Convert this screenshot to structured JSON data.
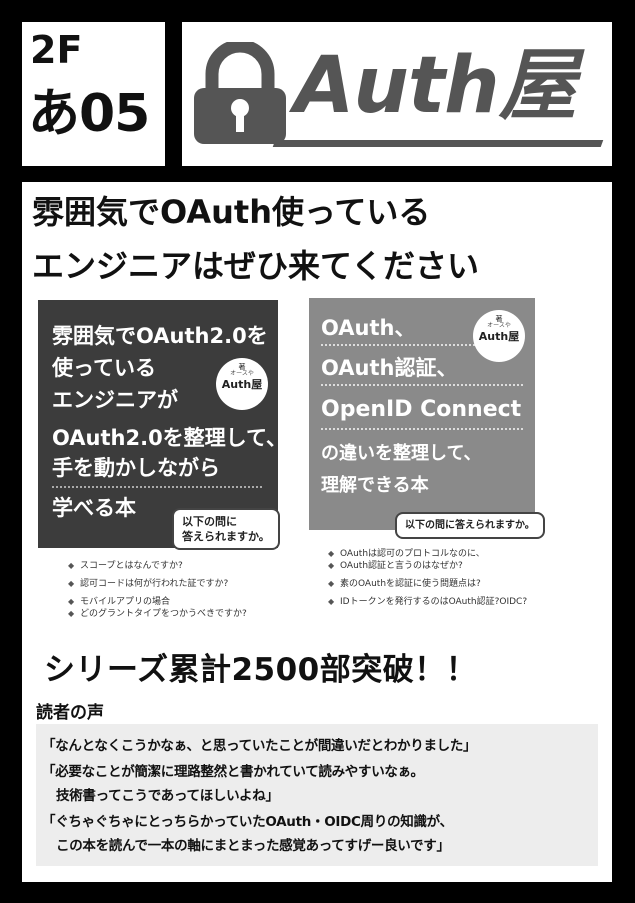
{
  "booth": {
    "floor": "2F",
    "number": "あ05"
  },
  "logo": {
    "text": "Auth屋",
    "icon": "lock-icon"
  },
  "headline": {
    "line1": "雰囲気でOAuth使っている",
    "line2": "エンジニアはぜひ来てください"
  },
  "book1": {
    "title_lines": [
      "雰囲気でOAuth2.0を",
      "使っている",
      "エンジニアが",
      "OAuth2.0を整理して、",
      "手を動かしながら",
      "学べる本"
    ],
    "badge": {
      "small": "著",
      "ruby": "オースや",
      "name": "Auth屋"
    },
    "bubble": [
      "以下の問に",
      "答えられますか。"
    ],
    "questions": [
      "スコープとはなんですか?",
      "認可コードは何が行われた証ですか?",
      "モバイルアプリの場合",
      "どのグラントタイプをつかうべきですか?"
    ]
  },
  "book2": {
    "title_lines": [
      "OAuth、",
      "OAuth認証、",
      "OpenID Connect",
      "の違いを整理して、",
      "理解できる本"
    ],
    "badge": {
      "small": "著",
      "ruby": "オースや",
      "name": "Auth屋"
    },
    "bubble": "以下の問に答えられますか。",
    "questions": [
      "OAuthは認可のプロトコルなのに、",
      "OAuth認証と言うのはなぜか?",
      "素のOAuthを認証に使う問題点は?",
      "IDトークンを発行するのはOAuth認証?OIDC?"
    ]
  },
  "series": "シリーズ累計2500部突破！！",
  "reviews": {
    "title": "読者の声",
    "lines": [
      "「なんとなくこうかなぁ、と思っていたことが間違いだとわかりました」",
      "「必要なことが簡潔に理路整然と書かれていて読みやすいなぁ。",
      "技術書ってこうであってほしいよね」",
      "「ぐちゃぐちゃにとっちらかっていたOAuth・OIDC周りの知識が、",
      "この本を読んで一本の軸にまとまった感覚あってすげー良いです」"
    ]
  },
  "colors": {
    "background": "#000000",
    "panel": "#ffffff",
    "logo": "#555555",
    "cover1": "#3c3c3c",
    "cover2": "#8a8a8a",
    "review_bg": "#ededed"
  }
}
